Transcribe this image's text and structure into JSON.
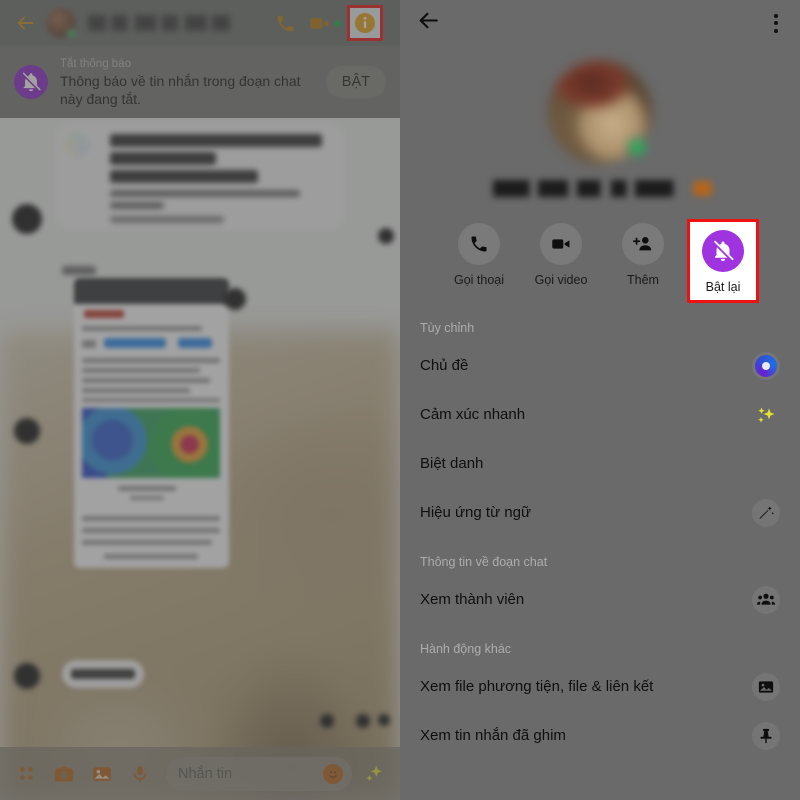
{
  "left_screen": {
    "header": {
      "back_icon": "back-arrow-icon",
      "avatar": "contact-avatar",
      "contact_name_blurred": "",
      "call_icon": "phone-call-icon",
      "video_icon": "video-call-icon",
      "info_icon": "info-circle-icon",
      "info_highlighted": true
    },
    "notification_banner": {
      "icon": "bell-muted-icon",
      "title": "Tắt thông báo",
      "body": "Thông báo về tin nhắn trong đoạn chat này đang tắt.",
      "action_label": "BẬT"
    },
    "composer": {
      "apps_icon": "apps-grid-icon",
      "camera_icon": "camera-icon",
      "gallery_icon": "gallery-icon",
      "mic_icon": "microphone-icon",
      "input_placeholder": "Nhắn tin",
      "emoji_icon": "emoji-smiley-icon",
      "sparkle_icon": "sparkles-icon"
    }
  },
  "right_screen": {
    "header": {
      "back_icon": "back-arrow-icon",
      "overflow_icon": "more-vertical-icon"
    },
    "profile": {
      "avatar": "contact-avatar",
      "online_badge": "online-status-dot",
      "name_blurred": ""
    },
    "actions": [
      {
        "icon": "phone-call-icon",
        "label": "Gọi thoại",
        "highlighted": false
      },
      {
        "icon": "video-call-icon",
        "label": "Gọi video",
        "highlighted": false
      },
      {
        "icon": "add-person-icon",
        "label": "Thêm",
        "highlighted": false
      },
      {
        "icon": "bell-muted-icon",
        "label": "Bật lại",
        "highlighted": true
      }
    ],
    "sections": [
      {
        "title": "Tùy chỉnh",
        "rows": [
          {
            "label": "Chủ đề",
            "icon": "theme-color-icon"
          },
          {
            "label": "Cảm xúc nhanh",
            "icon": "sparkles-icon"
          },
          {
            "label": "Biệt danh",
            "icon": ""
          },
          {
            "label": "Hiệu ứng từ ngữ",
            "icon": "magic-wand-icon"
          }
        ]
      },
      {
        "title": "Thông tin về đoạn chat",
        "rows": [
          {
            "label": "Xem thành viên",
            "icon": "people-group-icon"
          }
        ]
      },
      {
        "title": "Hành động khác",
        "rows": [
          {
            "label": "Xem file phương tiện, file & liên kết",
            "icon": "image-icon"
          },
          {
            "label": "Xem tin nhắn đã ghim",
            "icon": "pin-icon"
          }
        ]
      }
    ]
  },
  "colors": {
    "highlight_border": "#ee1111",
    "accent_purple": "#a033e0",
    "banner_purple": "#8c27c9",
    "info_amber": "#e8a317",
    "online_green": "#1db954",
    "dim_overlay": "#4e4e4e"
  }
}
